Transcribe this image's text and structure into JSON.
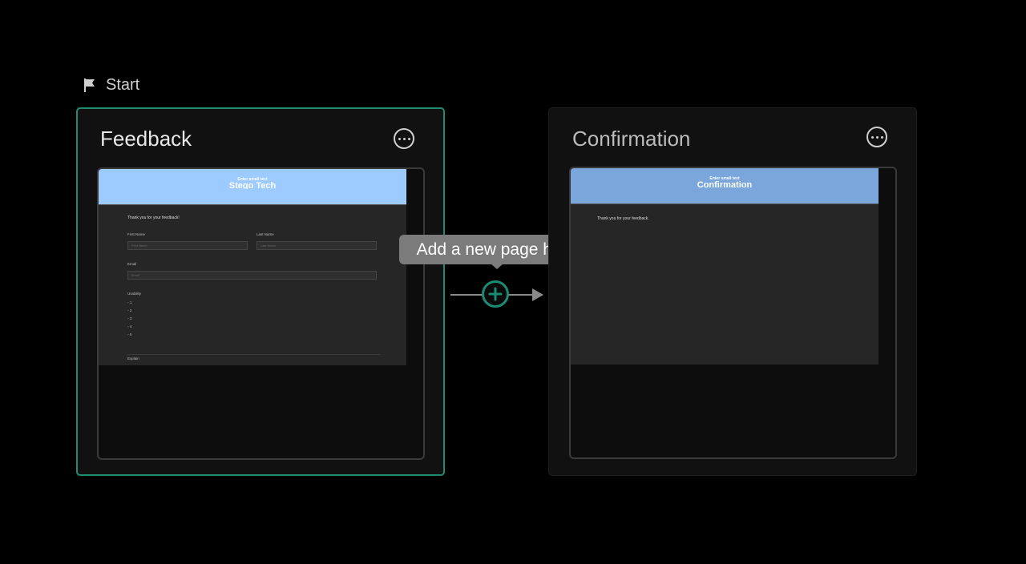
{
  "start": {
    "label": "Start",
    "icon": "flag-icon"
  },
  "pages": [
    {
      "title": "Feedback",
      "selected": true,
      "preview": {
        "header_small": "Enter small text",
        "header_big": "Stego Tech",
        "intro": "Thank you for your feedback!",
        "first_name_label": "First Name",
        "first_name_placeholder": "First Name",
        "last_name_label": "Last Name",
        "last_name_placeholder": "Last Name",
        "email_label": "Email",
        "email_placeholder": "Email",
        "usability_label": "Usability",
        "options": [
          "1",
          "2",
          "3",
          "4",
          "5"
        ],
        "explain_label": "Explain"
      }
    },
    {
      "title": "Confirmation",
      "selected": false,
      "preview": {
        "header_small": "Enter small text",
        "header_big": "Confirmation",
        "intro": "Thank you for your feedback."
      }
    }
  ],
  "connector": {
    "tooltip": "Add a new page here",
    "add_icon": "plus-circle-icon"
  },
  "colors": {
    "selected_border": "#1e8a72",
    "add_button": "#1a8c73",
    "header_feedback": "#9ecbff",
    "header_confirmation": "#7aa6dc"
  }
}
